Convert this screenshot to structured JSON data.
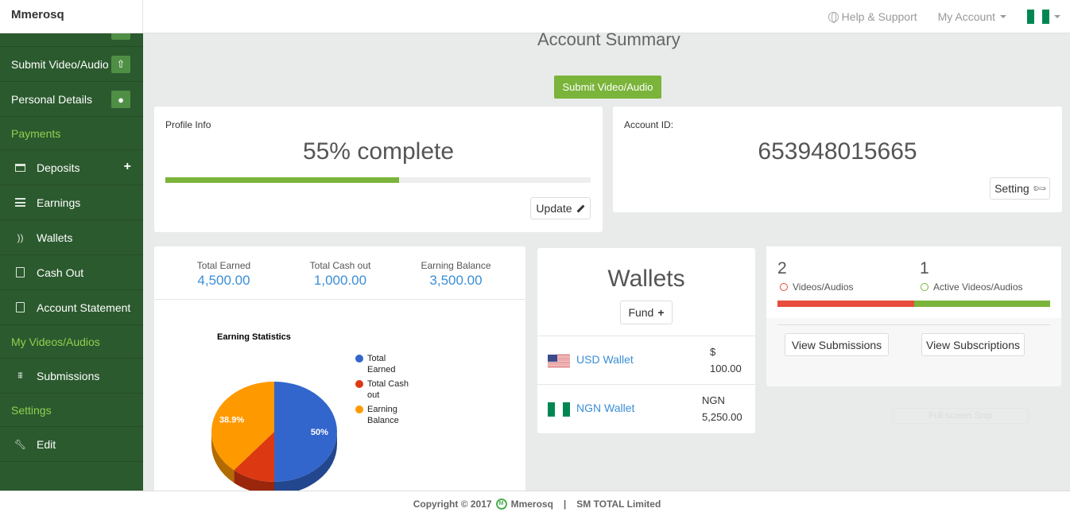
{
  "header": {
    "brand": "Mmerosq",
    "help_label": "Help & Support",
    "account_label": "My Account"
  },
  "sidebar": {
    "items_top": [
      {
        "label": "Submit Video/Audio",
        "icon": "upload-icon"
      },
      {
        "label": "Personal Details",
        "icon": "user-icon"
      }
    ],
    "payments_heading": "Payments",
    "payments": [
      {
        "label": "Deposits",
        "icon": "credit-card-icon"
      },
      {
        "label": "Earnings",
        "icon": "list-icon"
      },
      {
        "label": "Wallets",
        "icon": "wallet-icon"
      },
      {
        "label": "Cash Out",
        "icon": "cash-out-icon"
      },
      {
        "label": "Account Statement",
        "icon": "document-icon"
      }
    ],
    "videos_heading": "My Videos/Audios",
    "videos": [
      {
        "label": "Submissions",
        "icon": "submissions-icon"
      }
    ],
    "settings_heading": "Settings",
    "settings": [
      {
        "label": "Edit",
        "icon": "wrench-icon"
      }
    ]
  },
  "main": {
    "title": "Account Summary",
    "submit_button": "Submit Video/Audio",
    "profile": {
      "label": "Profile Info",
      "complete_text": "55% complete",
      "progress_percent": 55,
      "update_button": "Update"
    },
    "account": {
      "label": "Account ID:",
      "id": "653948015665",
      "setting_button": "Setting"
    },
    "stats": [
      {
        "label": "Total Earned",
        "value": "4,500.00"
      },
      {
        "label": "Total Cash out",
        "value": "1,000.00"
      },
      {
        "label": "Earning Balance",
        "value": "3,500.00"
      }
    ],
    "wallets": {
      "title": "Wallets",
      "fund_button": "Fund",
      "rows": [
        {
          "name": "USD Wallet",
          "currency": "$",
          "amount": "100.00"
        },
        {
          "name": "NGN Wallet",
          "currency": "NGN",
          "amount": "5,250.00"
        }
      ]
    },
    "videos": {
      "count": "2",
      "count_label": "Videos/Audios",
      "active_count": "1",
      "active_label": "Active Videos/Audios",
      "view_submissions": "View Submissions",
      "view_subscriptions": "View Subscriptions"
    },
    "snip_label": "Full-screen Snip"
  },
  "colors": {
    "sidebar_bg": "#2b5a2e",
    "accent_green": "#7ab43a",
    "link_blue": "#3a8ed6",
    "red": "#e74c3c"
  },
  "chart_data": {
    "type": "pie",
    "title": "Earning Statistics",
    "categories": [
      "Total Earned",
      "Total Cash out",
      "Earning Balance"
    ],
    "values": [
      50,
      11.1,
      38.9
    ],
    "data_labels": [
      "50%",
      "",
      "38.9%"
    ],
    "colors": [
      "#3366cc",
      "#dc3912",
      "#ff9900"
    ],
    "legend_position": "right"
  },
  "footer": {
    "copyright": "Copyright © 2017",
    "brand": "Mmerosq",
    "separator": "|",
    "company": "SM TOTAL Limited"
  }
}
